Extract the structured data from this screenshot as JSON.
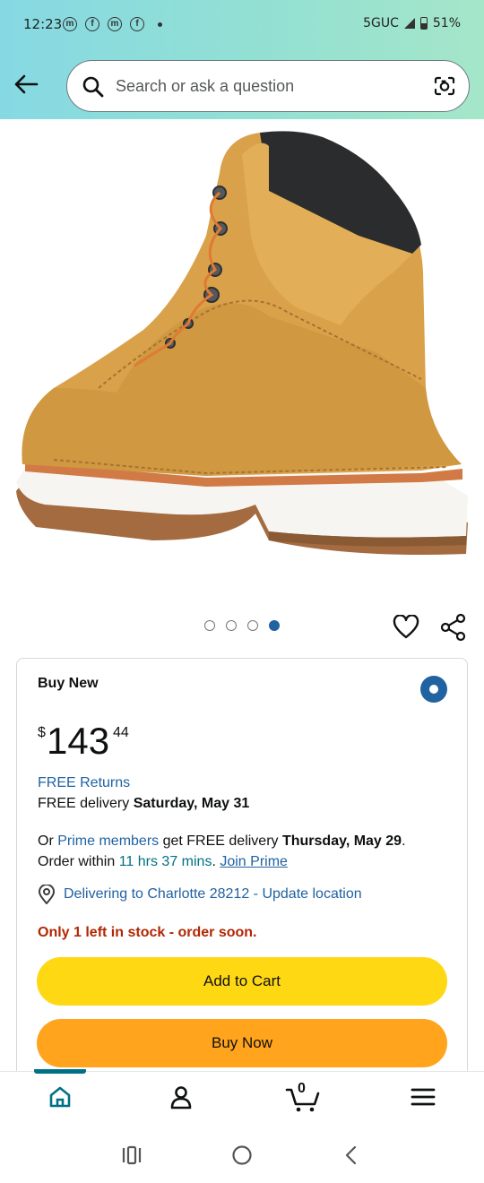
{
  "status_bar": {
    "time": "12:23",
    "network": "5GUC",
    "battery": "51%"
  },
  "search": {
    "placeholder": "Search or ask a question"
  },
  "gallery": {
    "image_count": 4,
    "active_index": 3
  },
  "buy_box": {
    "title": "Buy New",
    "price": {
      "symbol": "$",
      "whole": "143",
      "fraction": "44"
    },
    "free_returns": "FREE Returns",
    "delivery_prefix": "FREE delivery",
    "delivery_date": "Saturday, May 31",
    "prime_or": "Or",
    "prime_members": "Prime members",
    "prime_get": "get FREE delivery",
    "prime_date": "Thursday, May 29",
    "order_within_prefix": "Order within",
    "order_within_time": "11 hrs 37 mins",
    "join_prime": "Join Prime",
    "location": "Delivering to Charlotte 28212 - Update location",
    "stock": "Only 1 left in stock - order soon.",
    "add_to_cart": "Add to Cart",
    "buy_now": "Buy Now"
  },
  "bottom_nav": {
    "cart_count": "0",
    "items": [
      "home-icon",
      "account-icon",
      "cart-icon",
      "menu-icon"
    ]
  },
  "colors": {
    "link": "#2162a1",
    "teal": "#007185",
    "stock": "#b12704",
    "add_cart": "#ffd814",
    "buy_now": "#ffa41c"
  }
}
